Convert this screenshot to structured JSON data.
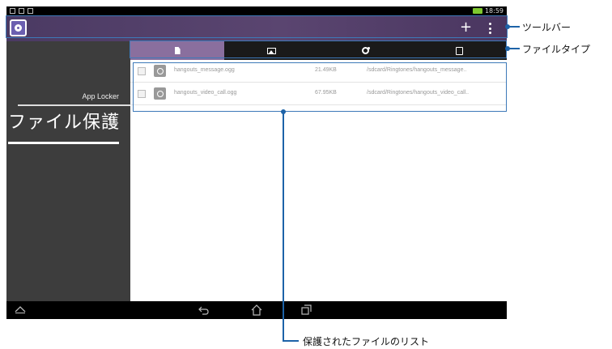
{
  "status_bar": {
    "clock": "18:59"
  },
  "toolbar": {
    "add_label": "+"
  },
  "sidebar": {
    "app_name": "App Locker",
    "title": "ファイル保護"
  },
  "tabs": [
    {
      "icon": "document-icon",
      "active": true
    },
    {
      "icon": "image-icon",
      "active": false
    },
    {
      "icon": "music-icon",
      "active": false
    },
    {
      "icon": "app-icon",
      "active": false
    }
  ],
  "files": [
    {
      "name": "hangouts_message.ogg",
      "size": "21.49KB",
      "path": "/sdcard/Ringtones/hangouts_message.."
    },
    {
      "name": "hangouts_video_call.ogg",
      "size": "67.95KB",
      "path": "/sdcard/Ringtones/hangouts_video_call.."
    }
  ],
  "callouts": {
    "toolbar": "ツールバー",
    "file_type": "ファイルタイプ",
    "protected_list": "保護されたファイルのリスト"
  },
  "colors": {
    "toolbar": "#4b3a63",
    "active_tab": "#8a6f9e",
    "sidebar": "#3d3d3d",
    "callout": "#1d63a8",
    "battery": "#7ec82e"
  }
}
